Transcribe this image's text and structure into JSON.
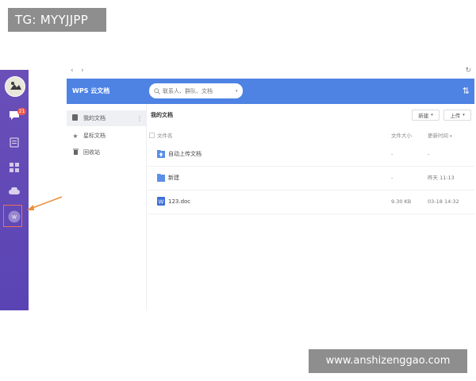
{
  "watermark_top": "TG: MYYJJPP",
  "watermark_bottom": "www.anshizenggao.com",
  "rail": {
    "badge_count": "21",
    "items": [
      "avatar",
      "chat-icon",
      "doc-icon",
      "apps-icon",
      "cloud-icon",
      "wps-cloud-icon"
    ]
  },
  "nav": {
    "back": "‹",
    "forward": "›"
  },
  "header": {
    "title": "WPS 云文档",
    "search_placeholder": "联系人、群队、文档",
    "sort_glyph": "⇅"
  },
  "sidebar": {
    "items": [
      {
        "label": "我的文档",
        "icon": "folder-icon"
      },
      {
        "label": "星标文档",
        "icon": "star-icon"
      },
      {
        "label": "回收站",
        "icon": "trash-icon"
      }
    ]
  },
  "main": {
    "title": "我的文档",
    "new_button": "新建",
    "upload_button": "上传",
    "columns": {
      "name": "文件名",
      "size": "文件大小",
      "modified": "更新时间"
    },
    "rows": [
      {
        "name": "自动上传文档",
        "size": "-",
        "modified": "-",
        "icon": "upload-folder-icon"
      },
      {
        "name": "新建",
        "size": "-",
        "modified": "昨天 11:13",
        "icon": "folder-icon"
      },
      {
        "name": "123.doc",
        "size": "9.30 KB",
        "modified": "03-18 14:32",
        "icon": "word-doc-icon"
      }
    ]
  },
  "colors": {
    "rail": "#5a44b4",
    "header": "#4e83e4",
    "highlight": "#ef6d5a",
    "arrow": "#ec8e3a"
  }
}
